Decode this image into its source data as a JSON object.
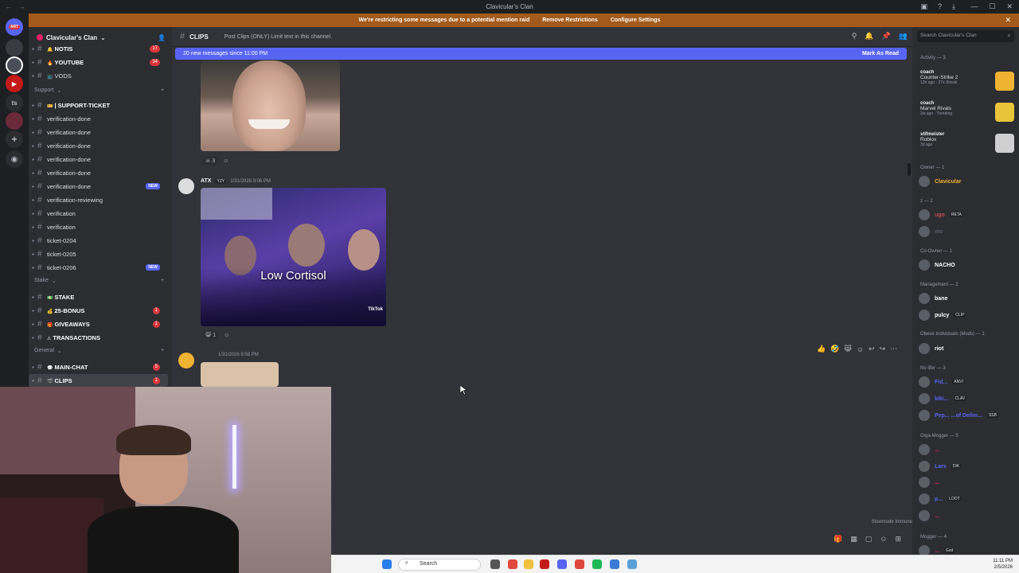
{
  "window": {
    "title": "Clavicular's Clan"
  },
  "notice": {
    "text": "We're restricting some messages due to a potential mention raid",
    "remove": "Remove Restrictions",
    "configure": "Configure Settings"
  },
  "server": {
    "name": "Clavicular's Clan"
  },
  "rail": {
    "badges": [
      "ART"
    ]
  },
  "sidebar": {
    "categories": [
      {
        "label": "Support"
      },
      {
        "label": "Stake"
      },
      {
        "label": "General"
      }
    ],
    "channels": [
      {
        "name": "NOTIS",
        "badge": "17",
        "emoji": "🔔",
        "bold": true
      },
      {
        "name": "YOUTUBE",
        "badge": "34",
        "emoji": "🔥",
        "bold": true
      },
      {
        "name": "VODS",
        "badge": "",
        "emoji": "📺",
        "bold": false
      },
      {
        "name": "| SUPPORT-TICKET",
        "badge": "",
        "emoji": "🎫",
        "bold": true
      },
      {
        "name": "verification-done",
        "badge": "",
        "emoji": "",
        "bold": false
      },
      {
        "name": "verification-done",
        "badge": "",
        "emoji": "",
        "bold": false
      },
      {
        "name": "verification-done",
        "badge": "",
        "emoji": "",
        "bold": false
      },
      {
        "name": "verification-done",
        "badge": "",
        "emoji": "",
        "bold": false
      },
      {
        "name": "verification-done",
        "badge": "",
        "emoji": "",
        "bold": false
      },
      {
        "name": "verification-done",
        "new": "NEW",
        "emoji": "",
        "bold": false
      },
      {
        "name": "verification-reviewing",
        "badge": "",
        "emoji": "",
        "bold": false
      },
      {
        "name": "verification",
        "badge": "",
        "emoji": "",
        "bold": false
      },
      {
        "name": "verification",
        "badge": "",
        "emoji": "",
        "bold": false
      },
      {
        "name": "ticket-0204",
        "badge": "",
        "emoji": "",
        "bold": false
      },
      {
        "name": "ticket-0205",
        "badge": "",
        "emoji": "",
        "bold": false
      },
      {
        "name": "ticket-0206",
        "new": "NEW",
        "emoji": "",
        "bold": false
      },
      {
        "name": "STAKE",
        "badge": "",
        "emoji": "💵",
        "bold": true
      },
      {
        "name": "25-BONUS",
        "badge": "1",
        "emoji": "💰",
        "bold": true
      },
      {
        "name": "GIVEAWAYS",
        "badge": "1",
        "emoji": "🎁",
        "bold": true
      },
      {
        "name": "TRANSACTIONS",
        "badge": "",
        "emoji": "⚠",
        "bold": true
      },
      {
        "name": "MAIN-CHAT",
        "badge": "5",
        "emoji": "💬",
        "bold": true
      },
      {
        "name": "CLIPS",
        "badge": "1",
        "emoji": "🎬",
        "bold": true
      }
    ]
  },
  "chat": {
    "channel": "CLIPS",
    "topic": "Post Clips (ONLY) Limit text in this channel.",
    "new_messages": "20 new messages since 11:00 PM",
    "mark_read": "Mark As Read",
    "messages": [
      {
        "reaction_count": "3"
      },
      {
        "author": "ATX",
        "tag": "YZY",
        "time": "1/31/2026 9:06 PM",
        "caption": "Low Cortisol",
        "watermark": "TikTok",
        "reaction_count": "1"
      },
      {
        "time": "1/31/2026 9:58 PM"
      }
    ],
    "slowmode": "Slowmode Immune"
  },
  "members": {
    "search_placeholder": "Search Clavicular's Clan",
    "activity_header": "Activity — 3",
    "activities": [
      {
        "user": "coach",
        "game": "Counter-Strike 2",
        "sub": "12h ago · 27x Streak"
      },
      {
        "user": "coach",
        "game": "Marvel Rivals",
        "sub": "2w ago · Trending"
      },
      {
        "user": "stifmeister",
        "game": "Roblox",
        "sub": "3d ago"
      }
    ],
    "groups": [
      {
        "header": "Owner — 1",
        "members": [
          {
            "name": "Clavicular",
            "color": "#f0b232",
            "tag": ""
          }
        ]
      },
      {
        "header": "z — 2",
        "members": [
          {
            "name": "ugo",
            "color": "#c64c4c",
            "tag": "RETA"
          },
          {
            "name": "mo",
            "color": "#5a5e66",
            "tag": ""
          }
        ]
      },
      {
        "header": "Co-Owner — 1",
        "members": [
          {
            "name": "NACHO",
            "color": "#ffffff",
            "tag": ""
          }
        ]
      },
      {
        "header": "Management — 2",
        "members": [
          {
            "name": "bane",
            "color": "#ffffff",
            "tag": ""
          },
          {
            "name": "pulcy",
            "color": "#ffffff",
            "tag": "CLIP"
          }
        ]
      },
      {
        "header": "Obese Individuals (Mods) — 1",
        "members": [
          {
            "name": "riot",
            "color": "#ffffff",
            "tag": ""
          }
        ]
      },
      {
        "header": "No lifer — 3",
        "members": [
          {
            "name": "Fid...",
            "color": "#5865f2",
            "tag": "ANVI"
          },
          {
            "name": "kiki...",
            "color": "#5865f2",
            "tag": "CLAV"
          },
          {
            "name": "Pep... ...of Delim...",
            "color": "#5865f2",
            "tag": "SSB"
          }
        ]
      },
      {
        "header": "Giga-Mogger — 5",
        "members": [
          {
            "name": "...",
            "color": "#e91e63",
            "tag": ""
          },
          {
            "name": "Lars",
            "color": "#5865f2",
            "tag": "DIK"
          },
          {
            "name": "...",
            "color": "#e91e63",
            "tag": ""
          },
          {
            "name": "p...",
            "color": "#5865f2",
            "tag": "LOOT"
          },
          {
            "name": "...",
            "color": "#e91e63",
            "tag": ""
          }
        ]
      },
      {
        "header": "Mogger — 4",
        "members": [
          {
            "name": "...",
            "color": "#e91e63",
            "tag": "God"
          }
        ]
      }
    ]
  },
  "taskbar": {
    "search": "Search",
    "time": "11:11 PM",
    "date": "2/5/2026"
  },
  "colors": {
    "blurple": "#5865f2",
    "notice": "#a35a1a",
    "bg": "#313338",
    "sidebar": "#2b2d31"
  }
}
